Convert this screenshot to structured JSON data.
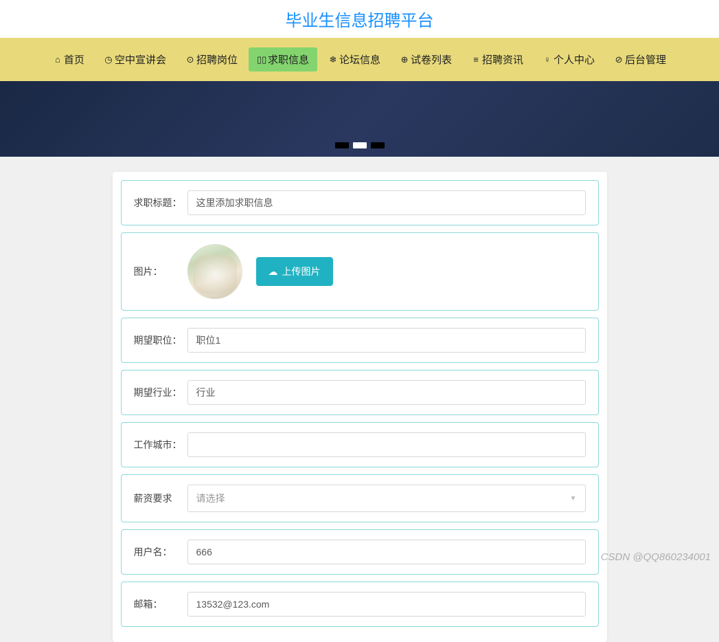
{
  "header": {
    "title": "毕业生信息招聘平台"
  },
  "nav": {
    "items": [
      {
        "icon": "⌂",
        "label": "首页"
      },
      {
        "icon": "◷",
        "label": "空中宣讲会"
      },
      {
        "icon": "⊙",
        "label": "招聘岗位"
      },
      {
        "icon": "▯▯",
        "label": "求职信息",
        "active": true
      },
      {
        "icon": "❄",
        "label": "论坛信息"
      },
      {
        "icon": "⊕",
        "label": "试卷列表"
      },
      {
        "icon": "≡",
        "label": "招聘资讯"
      },
      {
        "icon": "♀",
        "label": "个人中心"
      },
      {
        "icon": "⊘",
        "label": "后台管理"
      }
    ]
  },
  "carousel": {
    "active_index": 1,
    "count": 3
  },
  "form": {
    "title": {
      "label": "求职标题：",
      "value": "这里添加求职信息"
    },
    "image": {
      "label": "图片：",
      "upload_btn": "上传图片"
    },
    "position": {
      "label": "期望职位：",
      "value": "职位1"
    },
    "industry": {
      "label": "期望行业：",
      "value": "行业"
    },
    "city": {
      "label": "工作城市：",
      "value": ""
    },
    "salary": {
      "label": "薪资要求",
      "placeholder": "请选择"
    },
    "username": {
      "label": "用户名：",
      "value": "666"
    },
    "email": {
      "label": "邮箱：",
      "value": "13532@123.com"
    }
  },
  "watermark": "CSDN @QQ860234001"
}
